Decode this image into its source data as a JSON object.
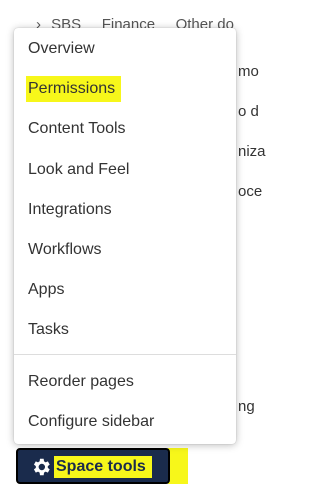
{
  "background": {
    "breadcrumb": [
      "SBS",
      "Finance",
      "Other do"
    ],
    "right_fragments": [
      "mo",
      "o d",
      "niza",
      "oce",
      "ng"
    ]
  },
  "menu": {
    "items": [
      {
        "label": "Overview"
      },
      {
        "label": "Permissions",
        "highlighted": true
      },
      {
        "label": "Content Tools"
      },
      {
        "label": "Look and Feel"
      },
      {
        "label": "Integrations"
      },
      {
        "label": "Workflows"
      },
      {
        "label": "Apps"
      },
      {
        "label": "Tasks"
      }
    ],
    "footer_items": [
      {
        "label": "Reorder pages"
      },
      {
        "label": "Configure sidebar"
      }
    ]
  },
  "space_tools": {
    "label": "Space tools",
    "icon": "gear-icon",
    "highlight_color": "#f7f71a",
    "button_color": "#1a2b4c"
  }
}
